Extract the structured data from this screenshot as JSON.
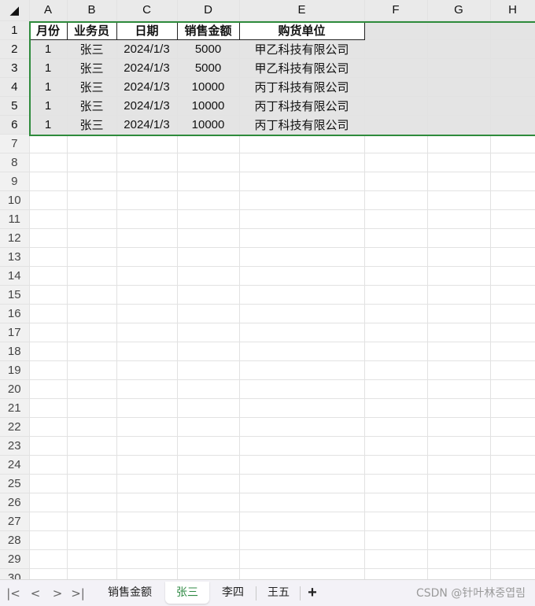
{
  "columns": [
    "A",
    "B",
    "C",
    "D",
    "E",
    "F",
    "G",
    "H"
  ],
  "headers": [
    "月份",
    "业务员",
    "日期",
    "销售金额",
    "购货单位"
  ],
  "rows": [
    [
      "1",
      "张三",
      "2024/1/3",
      "5000",
      "甲乙科技有限公司"
    ],
    [
      "1",
      "张三",
      "2024/1/3",
      "5000",
      "甲乙科技有限公司"
    ],
    [
      "1",
      "张三",
      "2024/1/3",
      "10000",
      "丙丁科技有限公司"
    ],
    [
      "1",
      "张三",
      "2024/1/3",
      "10000",
      "丙丁科技有限公司"
    ],
    [
      "1",
      "张三",
      "2024/1/3",
      "10000",
      "丙丁科技有限公司"
    ]
  ],
  "row_numbers": [
    "1",
    "2",
    "3",
    "4",
    "5",
    "6",
    "7",
    "8",
    "9",
    "10",
    "11",
    "12",
    "13",
    "14",
    "15",
    "16",
    "17",
    "18",
    "19",
    "20",
    "21",
    "22",
    "23",
    "24",
    "25",
    "26",
    "27",
    "28",
    "29",
    "30"
  ],
  "tabs": {
    "first": "销售金额",
    "active": "张三",
    "third": "李四",
    "fourth": "王五",
    "add": "+"
  },
  "nav": {
    "first": "|<",
    "prev": "<",
    "next": ">",
    "last": ">|"
  },
  "watermark": "CSDN @针叶林중엽림",
  "accent_color": "#2f8a44"
}
